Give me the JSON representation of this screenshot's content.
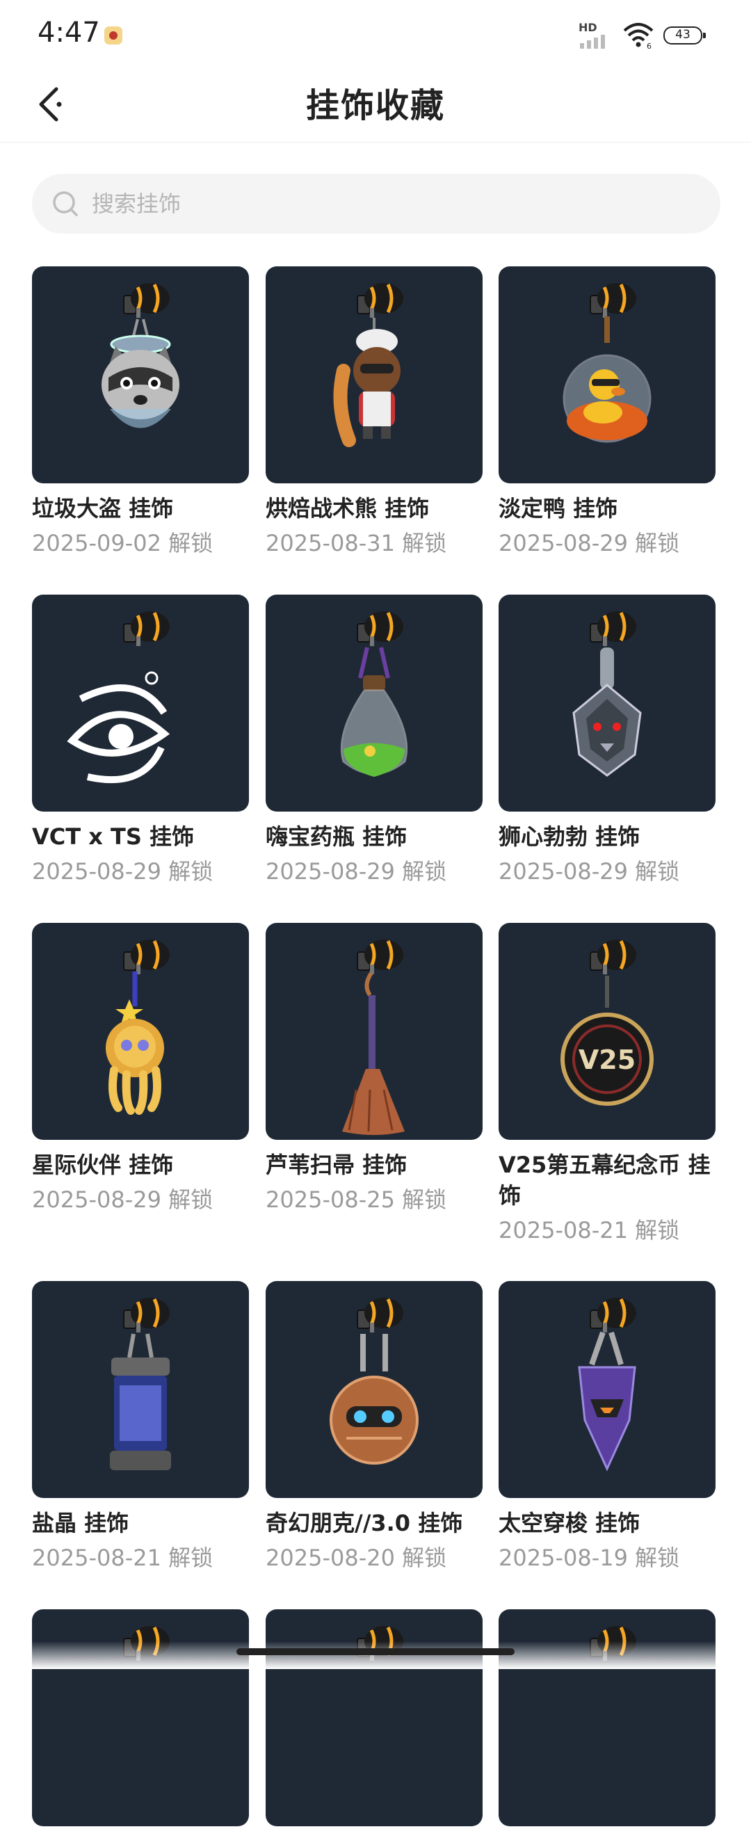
{
  "status_bar": {
    "time": "4:47",
    "network": "HD",
    "wifi_label": "6",
    "battery": "43"
  },
  "header": {
    "title": "挂饰收藏",
    "back_icon": "chevron-left-icon"
  },
  "search": {
    "placeholder": "搜索挂饰",
    "value": ""
  },
  "colors": {
    "card_bg": "#1f2936",
    "accent_orange": "#f5a623",
    "text_primary": "#222222",
    "text_secondary": "#9a9a9a"
  },
  "items": [
    {
      "name": "垃圾大盗 挂饰",
      "date": "2025-09-02 解锁",
      "icon": "raccoon-charm-icon"
    },
    {
      "name": "烘焙战术熊 挂饰",
      "date": "2025-08-31 解锁",
      "icon": "baker-bear-charm-icon"
    },
    {
      "name": "淡定鸭 挂饰",
      "date": "2025-08-29 解锁",
      "icon": "duck-orb-charm-icon"
    },
    {
      "name": "VCT x TS 挂饰",
      "date": "2025-08-29 解锁",
      "icon": "eye-emblem-charm-icon"
    },
    {
      "name": "嗨宝药瓶 挂饰",
      "date": "2025-08-29 解锁",
      "icon": "potion-bottle-charm-icon"
    },
    {
      "name": "狮心勃勃 挂饰",
      "date": "2025-08-29 解锁",
      "icon": "lion-head-charm-icon"
    },
    {
      "name": "星际伙伴 挂饰",
      "date": "2025-08-29 解锁",
      "icon": "octopus-charm-icon"
    },
    {
      "name": "芦苇扫帚 挂饰",
      "date": "2025-08-25 解锁",
      "icon": "broom-charm-icon"
    },
    {
      "name": "V25第五幕纪念币 挂饰",
      "date": "2025-08-21 解锁",
      "icon": "v25-coin-charm-icon"
    },
    {
      "name": "盐晶 挂饰",
      "date": "2025-08-21 解锁",
      "icon": "salt-canister-charm-icon"
    },
    {
      "name": "奇幻朋克//3.0 挂饰",
      "date": "2025-08-20 解锁",
      "icon": "fantasy-punk-charm-icon"
    },
    {
      "name": "太空穿梭 挂饰",
      "date": "2025-08-19 解锁",
      "icon": "space-shuttle-charm-icon"
    },
    {
      "name": "",
      "date": "",
      "icon": "partial-charm-icon"
    },
    {
      "name": "",
      "date": "",
      "icon": "partial-charm-icon"
    },
    {
      "name": "",
      "date": "",
      "icon": "partial-charm-icon"
    }
  ]
}
